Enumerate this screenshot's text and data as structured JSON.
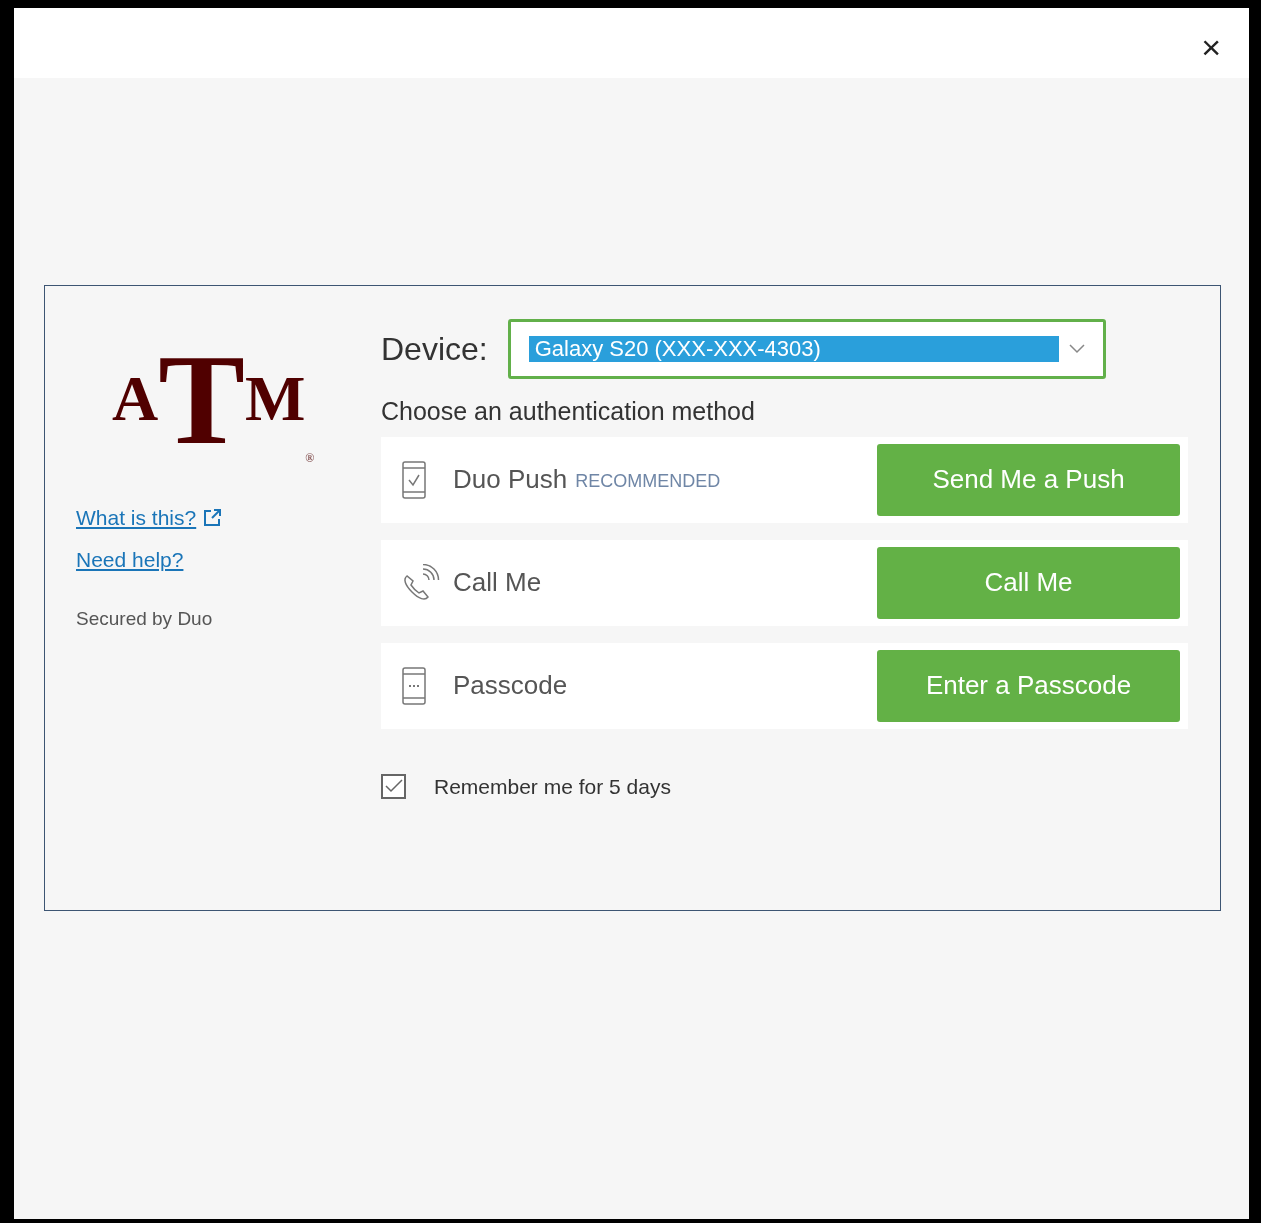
{
  "window": {
    "close": "×"
  },
  "logo": {
    "left": "A",
    "center": "T",
    "right": "M",
    "mark": "®"
  },
  "links": [
    {
      "label": "What is this?",
      "external": true
    },
    {
      "label": "Need help?",
      "external": false
    }
  ],
  "secured_by": "Secured by Duo",
  "device": {
    "label": "Device:",
    "value": "Galaxy S20 (XXX-XXX-4303)",
    "highlighted": true
  },
  "prompt": "Choose an authentication method",
  "methods": [
    {
      "kind": "push",
      "label": "Duo Push",
      "badge": "RECOMMENDED",
      "button": "Send Me a Push"
    },
    {
      "kind": "phone",
      "label": "Call Me",
      "button": "Call Me"
    },
    {
      "kind": "passcode",
      "label": "Passcode",
      "button": "Enter a Passcode"
    }
  ],
  "remember": {
    "label": "Remember me for 5 days",
    "checked": true
  }
}
